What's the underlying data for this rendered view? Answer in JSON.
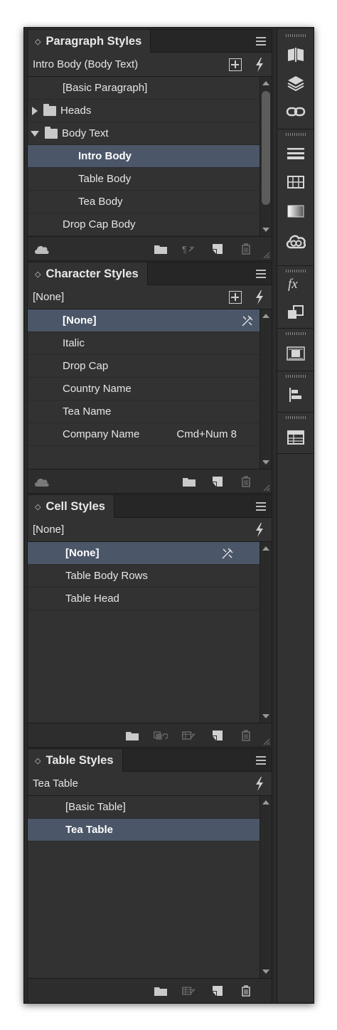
{
  "paragraph_styles": {
    "tab_label": "Paragraph Styles",
    "current_style": "Intro Body (Body Text)",
    "rows": [
      {
        "label": "[Basic Paragraph]",
        "indent": 1
      },
      {
        "label": "Heads",
        "indent": 0,
        "folder": true,
        "expanded": false
      },
      {
        "label": "Body Text",
        "indent": 0,
        "folder": true,
        "expanded": true
      },
      {
        "label": "Intro Body",
        "indent": 2,
        "selected": true
      },
      {
        "label": "Table Body",
        "indent": 2
      },
      {
        "label": "Tea Body",
        "indent": 2
      },
      {
        "label": "Drop Cap Body",
        "indent": 1
      }
    ]
  },
  "character_styles": {
    "tab_label": "Character Styles",
    "current_style": "[None]",
    "rows": [
      {
        "label": "[None]",
        "selected": true,
        "clear_icon": true
      },
      {
        "label": "Italic"
      },
      {
        "label": "Drop Cap"
      },
      {
        "label": "Country Name"
      },
      {
        "label": "Tea Name"
      },
      {
        "label": "Company Name",
        "shortcut": "Cmd+Num 8"
      }
    ]
  },
  "cell_styles": {
    "tab_label": "Cell Styles",
    "current_style": "[None]",
    "rows": [
      {
        "label": "[None]",
        "selected": true,
        "clear_icon": true
      },
      {
        "label": "Table Body Rows"
      },
      {
        "label": "Table Head"
      }
    ]
  },
  "table_styles": {
    "tab_label": "Table Styles",
    "current_style": "Tea Table",
    "rows": [
      {
        "label": "[Basic Table]"
      },
      {
        "label": "Tea Table",
        "selected": true
      }
    ]
  },
  "dock_icons": [
    "pages-icon",
    "layers-icon",
    "links-icon",
    "stroke-icon",
    "swatches-grid-icon",
    "gradient-icon",
    "creative-cloud-icon",
    "effects-icon",
    "transform-icon",
    "text-wrap-icon",
    "align-icon",
    "table-icon"
  ],
  "colors": {
    "panel_bg": "#323232",
    "selection": "#4b5668",
    "text": "#e6e6e6"
  }
}
